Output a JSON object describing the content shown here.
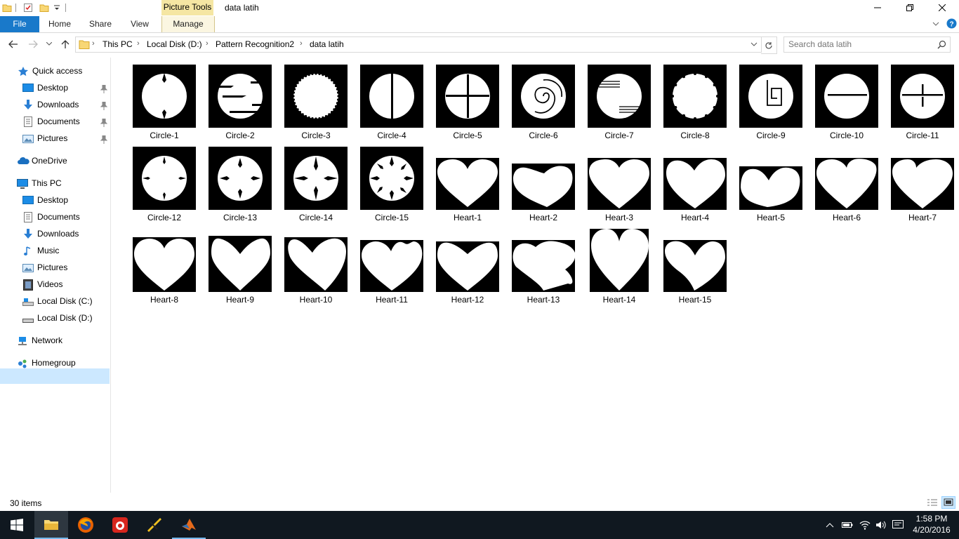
{
  "window": {
    "title": "data latih",
    "context_tab_group": "Picture Tools"
  },
  "ribbon": {
    "tabs": [
      "File",
      "Home",
      "Share",
      "View",
      "Manage"
    ]
  },
  "address": {
    "crumbs": [
      "This PC",
      "Local Disk (D:)",
      "Pattern Recognition2",
      "data latih"
    ],
    "search_placeholder": "Search data latih"
  },
  "nav": {
    "quick_access": "Quick access",
    "qa_desktop": "Desktop",
    "qa_downloads": "Downloads",
    "qa_documents": "Documents",
    "qa_pictures": "Pictures",
    "onedrive": "OneDrive",
    "this_pc": "This PC",
    "pc_desktop": "Desktop",
    "pc_documents": "Documents",
    "pc_downloads": "Downloads",
    "pc_music": "Music",
    "pc_pictures": "Pictures",
    "pc_videos": "Videos",
    "local_c": "Local Disk (C:)",
    "local_d": "Local Disk (D:)",
    "network": "Network",
    "homegroup": "Homegroup"
  },
  "files": [
    {
      "name": "Circle-1"
    },
    {
      "name": "Circle-2"
    },
    {
      "name": "Circle-3"
    },
    {
      "name": "Circle-4"
    },
    {
      "name": "Circle-5"
    },
    {
      "name": "Circle-6"
    },
    {
      "name": "Circle-7"
    },
    {
      "name": "Circle-8"
    },
    {
      "name": "Circle-9"
    },
    {
      "name": "Circle-10"
    },
    {
      "name": "Circle-11"
    },
    {
      "name": "Circle-12"
    },
    {
      "name": "Circle-13"
    },
    {
      "name": "Circle-14"
    },
    {
      "name": "Circle-15"
    },
    {
      "name": "Heart-1"
    },
    {
      "name": "Heart-2"
    },
    {
      "name": "Heart-3"
    },
    {
      "name": "Heart-4"
    },
    {
      "name": "Heart-5"
    },
    {
      "name": "Heart-6"
    },
    {
      "name": "Heart-7"
    },
    {
      "name": "Heart-8"
    },
    {
      "name": "Heart-9"
    },
    {
      "name": "Heart-10"
    },
    {
      "name": "Heart-11"
    },
    {
      "name": "Heart-12"
    },
    {
      "name": "Heart-13"
    },
    {
      "name": "Heart-14"
    },
    {
      "name": "Heart-15"
    }
  ],
  "status": {
    "item_count": "30 items"
  },
  "taskbar": {
    "time": "1:58 PM",
    "date": "4/20/2016"
  },
  "colors": {
    "accent": "#1979ca",
    "selection": "#cce8ff",
    "taskbar": "#101820",
    "context_tab": "#f5e6a3"
  }
}
